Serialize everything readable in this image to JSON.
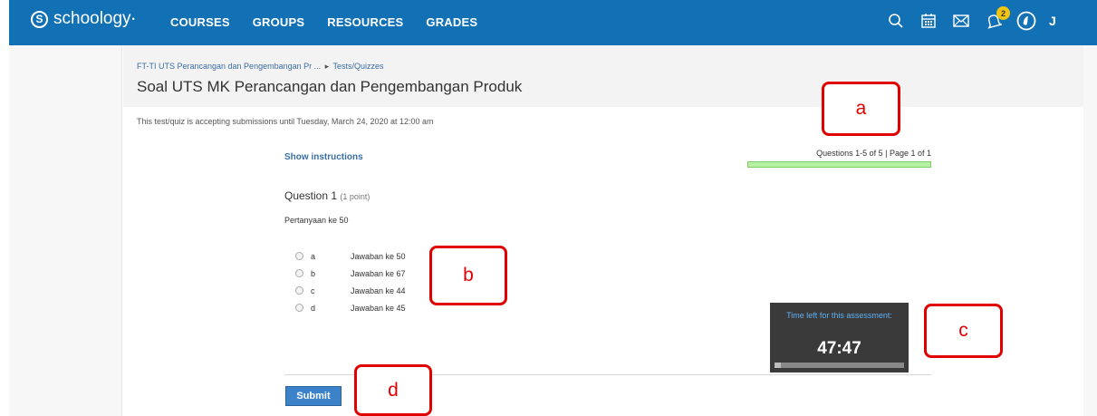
{
  "nav": {
    "logo": "schoology",
    "items": [
      "COURSES",
      "GROUPS",
      "RESOURCES",
      "GRADES"
    ],
    "notification_count": "2",
    "user_initial": "J"
  },
  "header": {
    "breadcrumb_course": "FT-TI UTS Perancangan dan Pengembangan Pr ...",
    "breadcrumb_section": "Tests/Quizzes",
    "title": "Soal UTS MK Perancangan dan Pengembangan Produk"
  },
  "availability": "This test/quiz is accepting submissions until Tuesday, March 24, 2020 at 12:00 am",
  "show_instructions": "Show instructions",
  "progress": {
    "text": "Questions 1-5 of 5 | Page 1 of 1",
    "fraction": 1.0
  },
  "question": {
    "title": "Question 1",
    "points": "(1 point)",
    "text": "Pertanyaan ke 50",
    "answers": [
      {
        "letter": "a",
        "text": "Jawaban ke 50"
      },
      {
        "letter": "b",
        "text": "Jawaban ke 67"
      },
      {
        "letter": "c",
        "text": "Jawaban ke 44"
      },
      {
        "letter": "d",
        "text": "Jawaban ke 45"
      }
    ]
  },
  "submit_label": "Submit",
  "timer": {
    "label": "Time left for this assessment:",
    "value": "47:47",
    "fraction_elapsed": 0.05
  },
  "callouts": [
    "a",
    "b",
    "c",
    "d"
  ],
  "colors": {
    "topbar": "#1271b5",
    "callout": "#e00000",
    "progress": "#b6f0a0",
    "submit": "#3c82c9"
  }
}
